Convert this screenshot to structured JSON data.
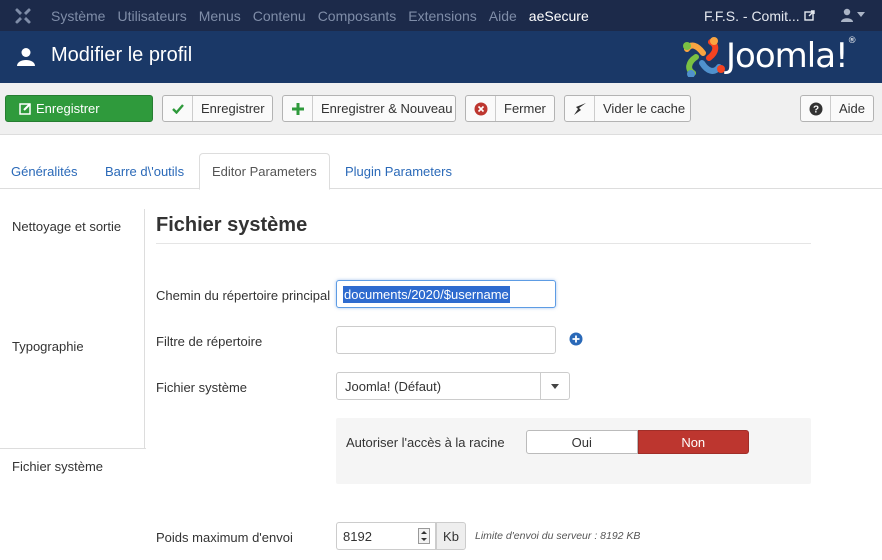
{
  "topbar": {
    "menu": [
      "Système",
      "Utilisateurs",
      "Menus",
      "Contenu",
      "Composants",
      "Extensions",
      "Aide",
      "aeSecure"
    ],
    "site_name": "F.F.S. - Comit...",
    "icons": {
      "logo": "joomla-icon",
      "external": "external-link-icon",
      "user": "user-icon",
      "caret": "caret-down-icon"
    }
  },
  "header": {
    "title": "Modifier le profil",
    "brand": "Joomla!",
    "trademark": "®"
  },
  "toolbar": {
    "save_primary": "Enregistrer",
    "save": "Enregistrer",
    "save_new": "Enregistrer & Nouveau",
    "close": "Fermer",
    "clear_cache": "Vider le cache",
    "help": "Aide"
  },
  "tabs": [
    "Généralités",
    "Barre d\\'outils",
    "Editor Parameters",
    "Plugin Parameters"
  ],
  "vtabs": [
    "Nettoyage et sortie",
    "Typographie",
    "Fichier système"
  ],
  "section": {
    "title": "Fichier système",
    "fields": {
      "root_path_label": "Chemin du répertoire principal",
      "root_path_value": "documents/2020/$username",
      "filter_label": "Filtre de répertoire",
      "filter_value": "",
      "fs_label": "Fichier système",
      "fs_value": "Joomla! (Défaut)",
      "root_access_label": "Autoriser l'accès à la racine",
      "root_access_yes": "Oui",
      "root_access_no": "Non",
      "root_access_selected": "Non",
      "max_upload_label": "Poids maximum d'envoi",
      "max_upload_value": "8192",
      "max_upload_unit": "Kb",
      "max_upload_hint": "Limite d'envoi du serveur : 8192 KB"
    }
  },
  "colors": {
    "topbar": "#1c2a4a",
    "header": "#1a3867",
    "primary": "#2f9a3c",
    "danger": "#bd362f",
    "link": "#2a69b8"
  }
}
